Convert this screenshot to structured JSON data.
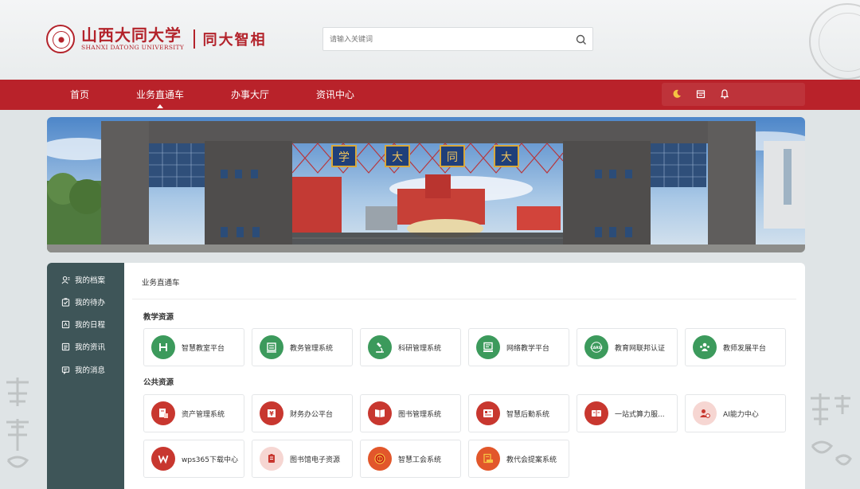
{
  "header": {
    "logo_cn": "山西大同大学",
    "logo_en": "SHANXI DATONG UNIVERSITY",
    "logo_sub": "同大智相",
    "search_placeholder": "请输入关键词"
  },
  "nav": {
    "items": [
      {
        "label": "首页"
      },
      {
        "label": "业务直通车"
      },
      {
        "label": "办事大厅"
      },
      {
        "label": "资讯中心"
      }
    ],
    "tools": [
      "moon-icon",
      "calendar-icon",
      "bell-icon"
    ]
  },
  "banner": {
    "gate_characters": [
      "学",
      "大",
      "同",
      "大"
    ]
  },
  "sidebar": {
    "items": [
      {
        "label": "我的档案",
        "icon": "user-profile-icon"
      },
      {
        "label": "我的待办",
        "icon": "todo-icon"
      },
      {
        "label": "我的日程",
        "icon": "schedule-icon"
      },
      {
        "label": "我的资讯",
        "icon": "news-icon"
      },
      {
        "label": "我的消息",
        "icon": "message-icon"
      }
    ]
  },
  "main": {
    "title": "业务直通车",
    "sections": [
      {
        "title": "教学资源",
        "cards": [
          {
            "label": "智慧教室平台",
            "icon": "smart-classroom-icon",
            "color": "#3c9a5c"
          },
          {
            "label": "教务管理系统",
            "icon": "academic-affairs-icon",
            "color": "#3c9a5c"
          },
          {
            "label": "科研管理系统",
            "icon": "microscope-icon",
            "color": "#3c9a5c"
          },
          {
            "label": "网络教学平台",
            "icon": "online-teaching-icon",
            "color": "#3c9a5c"
          },
          {
            "label": "教育网联邦认证",
            "icon": "carsi-icon",
            "color": "#3c9a5c"
          },
          {
            "label": "教师发展平台",
            "icon": "teacher-development-icon",
            "color": "#3c9a5c"
          }
        ]
      },
      {
        "title": "公共资源",
        "cards": [
          {
            "label": "资产管理系统",
            "icon": "asset-icon",
            "color": "#c8372f"
          },
          {
            "label": "财务办公平台",
            "icon": "finance-icon",
            "color": "#c8372f"
          },
          {
            "label": "图书管理系统",
            "icon": "book-icon",
            "color": "#c8372f"
          },
          {
            "label": "智慧后勤系统",
            "icon": "logistics-icon",
            "color": "#c8372f"
          },
          {
            "label": "一站式算力服...",
            "icon": "computing-icon",
            "color": "#c8372f"
          },
          {
            "label": "AI能力中心",
            "icon": "ai-icon",
            "color": "#f6d6d2"
          },
          {
            "label": "wps365下载中心",
            "icon": "wps-icon",
            "color": "#c8372f"
          },
          {
            "label": "图书馆电子资源",
            "icon": "library-resource-icon",
            "color": "#f6d6d2"
          },
          {
            "label": "智慧工会系统",
            "icon": "union-icon",
            "color": "#e2572b"
          },
          {
            "label": "教代会提案系统",
            "icon": "proposal-icon",
            "color": "#e2572b"
          }
        ]
      }
    ]
  },
  "colors": {
    "brand_red": "#b9222a",
    "sidebar": "#3e5558",
    "green": "#3c9a5c"
  }
}
